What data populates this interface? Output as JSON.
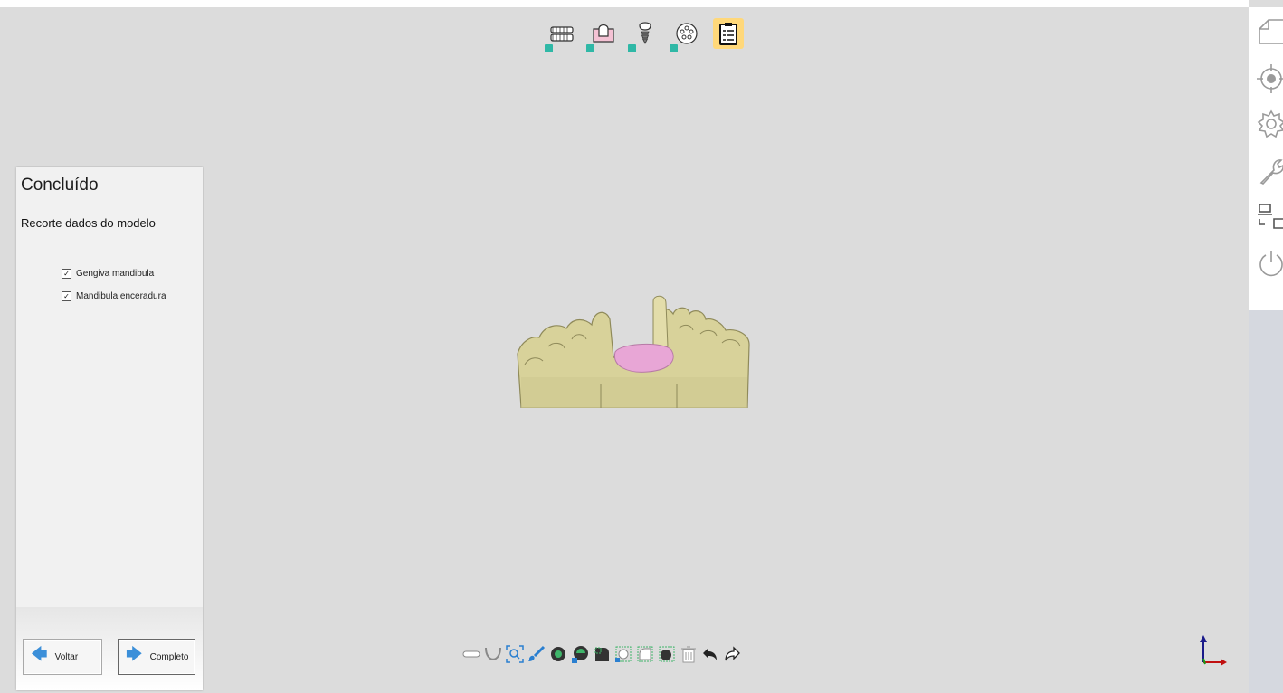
{
  "workflow": {
    "steps": [
      {
        "name": "dentes",
        "checked": true,
        "active": false
      },
      {
        "name": "gengiva",
        "checked": true,
        "active": false
      },
      {
        "name": "implante",
        "checked": true,
        "active": false
      },
      {
        "name": "biblioteca",
        "checked": true,
        "active": false
      },
      {
        "name": "resumo",
        "checked": false,
        "active": true
      }
    ]
  },
  "panel": {
    "title": "Concluído",
    "subtitle": "Recorte dados do modelo",
    "items": [
      {
        "label": "Gengiva mandibula",
        "checked": true
      },
      {
        "label": "Mandibula enceradura",
        "checked": true
      }
    ],
    "back_label": "Voltar",
    "complete_label": "Completo"
  },
  "toolbar": {
    "icons": [
      "jaw-upper-icon",
      "jaw-lower-icon",
      "zoom-fit-icon",
      "brush-icon",
      "view-front-icon",
      "view-side-icon",
      "view-bottom-icon",
      "view-box1-icon",
      "view-box2-icon",
      "view-box3-icon",
      "trash-icon",
      "undo-icon",
      "redo-icon"
    ]
  },
  "colors": {
    "background": "#dcdcdc",
    "model": "#d8d29a",
    "gingiva": "#e8a6d6",
    "accent": "#3b8fd9",
    "active_step": "#ffd87a",
    "check": "#2fb8a6"
  }
}
